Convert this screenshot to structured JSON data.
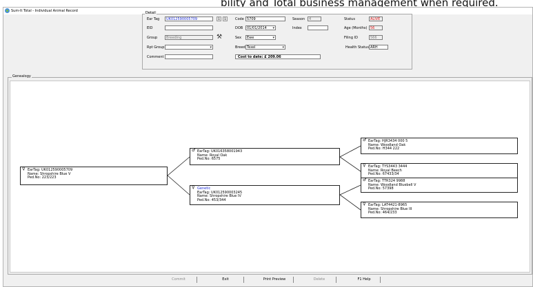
{
  "caption": "bility and Total business management when required.",
  "window": {
    "title": "Sum-It Total - Individual Animal Record"
  },
  "detail": {
    "section_label": "Detail",
    "ear_tag_label": "Ear Tag",
    "ear_tag_value": "UK012590005709",
    "eid_label": "EID",
    "group_label": "Group",
    "group_value": "Breeding",
    "rpt_group_label": "Rpt Group",
    "comment_label": "Comment",
    "code_label": "Code",
    "code_value": "5709",
    "dob_label": "DOB",
    "dob_value": "01/01/2014",
    "sex_label": "Sex",
    "sex_value": "Ewe",
    "breed_label": "Breed",
    "breed_value": "Texel",
    "cost_to_date": "Cost to date: £ 209.06",
    "season_label": "Season",
    "season_value": "4",
    "index_label": "Index",
    "status_label": "Status",
    "status_value": "ALIVE",
    "age_label": "Age (Months)",
    "age_value": "56",
    "filing_label": "Filing ID",
    "filing_value": "566",
    "health_label": "Health Status",
    "health_value": "ARH"
  },
  "genealogy": {
    "section_label": "Genealogy",
    "subject": {
      "sym": "♀",
      "ear_tag": "EarTag: UK012590005709",
      "name": "Name:   Shropshire Blue V",
      "ped": "Ped.No: 223/223"
    },
    "sire": {
      "sym": "♂",
      "ear_tag": "EarTag: UK016358001943",
      "name": "Name:    Royal Oak",
      "ped": "Ped.No: 6575"
    },
    "dam": {
      "sym": "♀",
      "tag": "Genetic",
      "ear_tag": "EarTag: UK012590003245",
      "name": "Name:   Shropshire Blue IV",
      "ped": "Ped.No: 453/344"
    },
    "ss": {
      "sym": "♂",
      "ear_tag": "EarTag: HJR3434 000 5",
      "name": "Name:    Woodland Oak",
      "ped": "Ped.No: H344 222"
    },
    "sd": {
      "sym": "♀",
      "ear_tag": "EarTag: TYS3443 3444",
      "name": "Name:    Royal Beech",
      "ped": "Ped.No: 67433/34"
    },
    "ds": {
      "sym": "♂",
      "ear_tag": "EarTag: TTR324 9988",
      "name": "Name:    Woodland Bluebell V",
      "ped": "Ped.No: 57398"
    },
    "dd": {
      "sym": "♀",
      "ear_tag": "EarTag: LAT4421-8965",
      "name": "Name:    Shropshire Blue III",
      "ped": "Ped.No: 464/233"
    }
  },
  "buttons": {
    "commit": "Commit",
    "exit": "Exit",
    "print_preview": "Print Preview",
    "delete": "Delete",
    "help": "F1 Help"
  }
}
